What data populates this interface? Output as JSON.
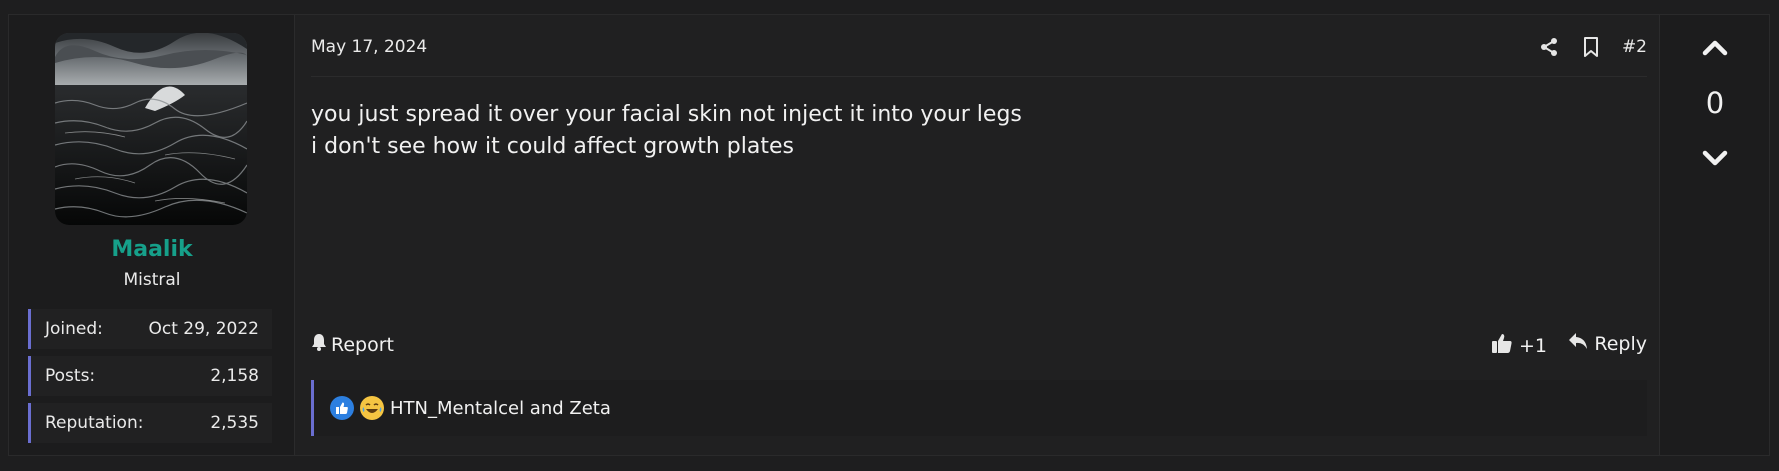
{
  "user": {
    "name": "Maalik",
    "title": "Mistral",
    "stats": [
      {
        "label": "Joined:",
        "value": "Oct 29, 2022"
      },
      {
        "label": "Posts:",
        "value": "2,158"
      },
      {
        "label": "Reputation:",
        "value": "2,535"
      }
    ],
    "name_color": "#16a08a"
  },
  "post": {
    "date": "May 17, 2024",
    "number": "#2",
    "body_lines": [
      "you just spread it over your facial skin not inject it into your legs",
      "i don't see how it could affect growth plates"
    ],
    "icons": [
      "share-icon",
      "bookmark-icon"
    ]
  },
  "actions": {
    "report_label": "Report",
    "like_label": "+1",
    "reply_label": "Reply"
  },
  "reactions": {
    "icons": [
      "like-reaction-icon",
      "laugh-reaction-icon"
    ],
    "text": "HTN_Mentalcel and Zeta"
  },
  "vote": {
    "count": "0"
  },
  "colors": {
    "accent": "#6a6ed0",
    "background": "#1e1e1f",
    "panel": "#202021"
  }
}
